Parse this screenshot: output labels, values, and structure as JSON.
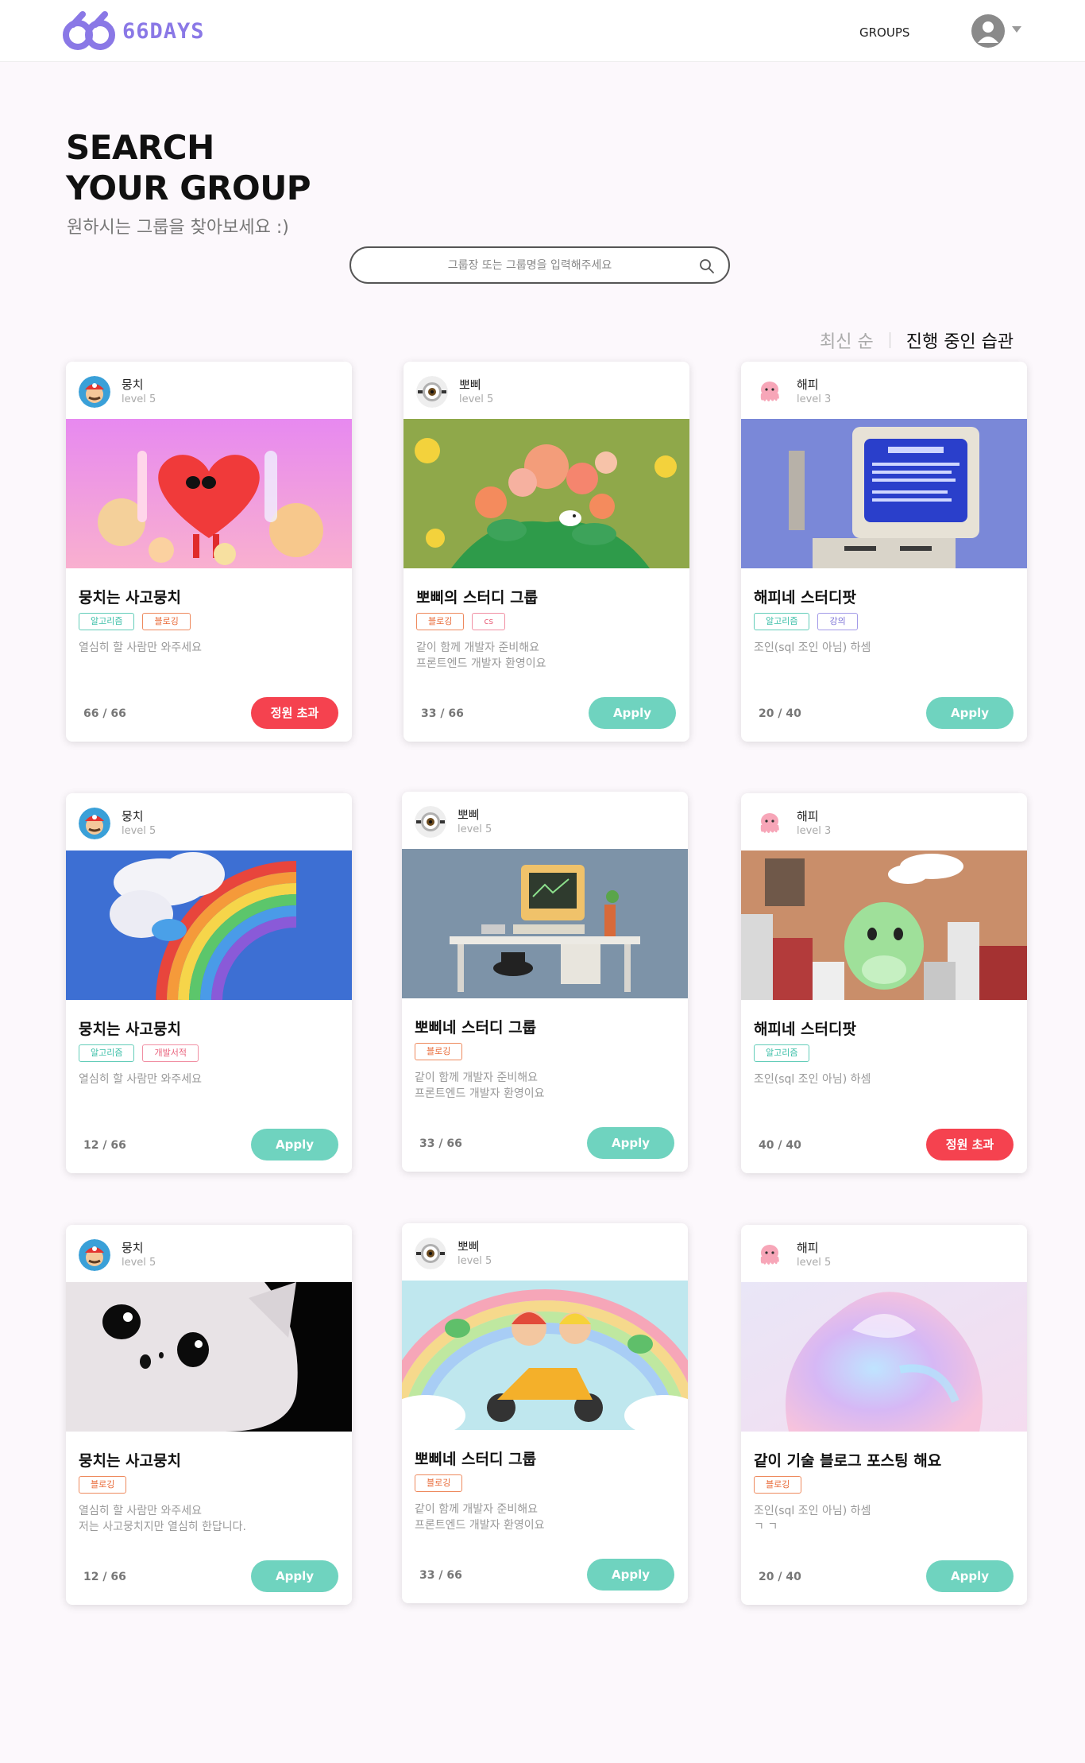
{
  "brand": {
    "logo_text": "66DAYS",
    "primary": "#8a78e6",
    "accent": "#6fd3bf",
    "danger": "#f5424f"
  },
  "nav": {
    "groups_label": "GROUPS"
  },
  "hero": {
    "title_line1": "SEARCH",
    "title_line2": "YOUR GROUP",
    "subtitle": "원하시는 그룹을 찾아보세요 :)"
  },
  "search": {
    "placeholder": "그룹장 또는 그룹명을 입력해주세요",
    "value": ""
  },
  "sort": {
    "latest": "최신 순",
    "active": "진행 중인 습관"
  },
  "cards": [
    {
      "owner": "뭉치",
      "level": "level 5",
      "avatar": "mario-avatar",
      "image": "heart-character",
      "title": "뭉치는 사고뭉치",
      "tags": [
        "알고리즘",
        "블로깅"
      ],
      "desc": "열심히 할 사람만 와주세요",
      "count": "66 / 66",
      "button": "정원 초과"
    },
    {
      "owner": "뽀삐",
      "level": "level 5",
      "avatar": "minion-avatar",
      "image": "flower-garden",
      "title": "뽀삐의 스터디 그룹",
      "tags": [
        "블로깅",
        "cs"
      ],
      "desc": "같이 함께 개발자 준비해요\n프론트엔드 개발자 환영이요",
      "count": "33 / 66",
      "button": "Apply"
    },
    {
      "owner": "해피",
      "level": "level 3",
      "avatar": "octopus-avatar",
      "image": "retro-computer",
      "title": "해피네 스터디팟",
      "tags": [
        "알고리즘",
        "강의"
      ],
      "desc": "조인(sql 조인 아님) 하셈",
      "count": "20 / 40",
      "button": "Apply"
    },
    {
      "owner": "뭉치",
      "level": "level 5",
      "avatar": "mario-avatar",
      "image": "rainbow-cloud",
      "title": "뭉치는 사고뭉치",
      "tags": [
        "알고리즘",
        "개발서적"
      ],
      "desc": "열심히 할 사람만 와주세요",
      "count": "12 / 66",
      "button": "Apply"
    },
    {
      "owner": "뽀삐",
      "level": "level 5",
      "avatar": "minion-avatar",
      "image": "desk-setup",
      "title": "뽀삐네 스터디 그룹",
      "tags": [
        "블로깅"
      ],
      "desc": "같이 함께 개발자 준비해요\n프론트엔드 개발자 환영이요",
      "count": "33 / 66",
      "button": "Apply"
    },
    {
      "owner": "해피",
      "level": "level 3",
      "avatar": "octopus-avatar",
      "image": "dino-city",
      "title": "해피네 스터디팟",
      "tags": [
        "알고리즘"
      ],
      "desc": "조인(sql 조인 아님) 하셈",
      "count": "40 / 40",
      "button": "정원 초과"
    },
    {
      "owner": "뭉치",
      "level": "level 5",
      "avatar": "mario-avatar",
      "image": "white-cat-face",
      "title": "뭉치는 사고뭉치",
      "tags": [
        "블로깅"
      ],
      "desc": "열심히 할 사람만 와주세요\n저는 사고뭉치지만 열심히 한답니다.",
      "count": "12 / 66",
      "button": "Apply"
    },
    {
      "owner": "뽀삐",
      "level": "level 5",
      "avatar": "minion-avatar",
      "image": "scooter-rainbow",
      "title": "뽀삐네 스터디 그룹",
      "tags": [
        "블로깅"
      ],
      "desc": "같이 함께 개발자 준비해요\n프론트엔드 개발자 환영이요",
      "count": "33 / 66",
      "button": "Apply"
    },
    {
      "owner": "해피",
      "level": "level 5",
      "avatar": "octopus-avatar",
      "image": "iridescent-blob",
      "title": "같이 기술 블로그 포스팅 해요",
      "tags": [
        "블로깅"
      ],
      "desc": "조인(sql 조인 아님) 하셈\nㄱ ㄱ",
      "count": "20 / 40",
      "button": "Apply"
    }
  ]
}
